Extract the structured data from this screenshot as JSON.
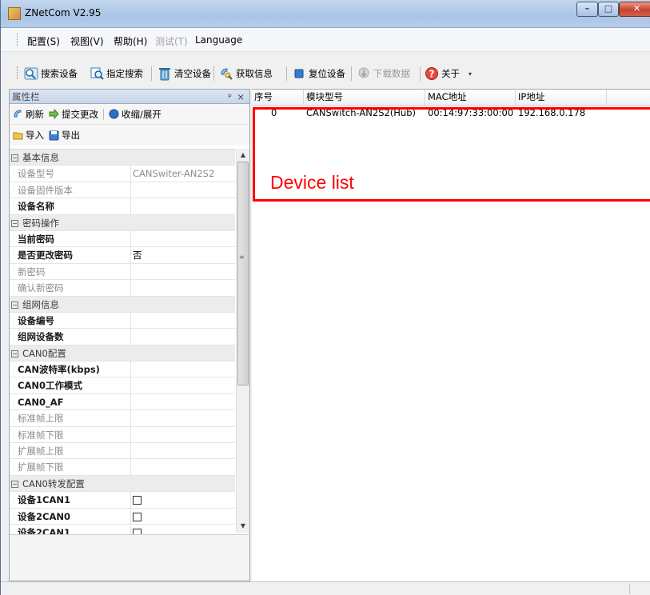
{
  "window": {
    "title": "ZNetCom V2.95"
  },
  "menu": [
    {
      "label": "配置(S)",
      "enabled": true
    },
    {
      "label": "视图(V)",
      "enabled": true
    },
    {
      "label": "帮助(H)",
      "enabled": true
    },
    {
      "label": "测试(T)",
      "enabled": false
    },
    {
      "label": "Language",
      "enabled": true
    }
  ],
  "toolbar": {
    "search_devices": "搜索设备",
    "specified_search": "指定搜索",
    "clear_devices": "清空设备",
    "get_info": "获取信息",
    "reset_device": "复位设备",
    "download_data": "下载数据",
    "about": "关于"
  },
  "property_panel": {
    "title": "属性栏",
    "pin_glyph": "ᵖ",
    "close_glyph": "×",
    "refresh": "刷新",
    "submit_changes": "提交更改",
    "collapse_expand": "收缩/展开",
    "import": "导入",
    "export": "导出",
    "rows": [
      {
        "type": "cat",
        "label": "基本信息"
      },
      {
        "type": "ro",
        "label": "设备型号",
        "value": "CANSwiter-AN2S2"
      },
      {
        "type": "ro",
        "label": "设备固件版本",
        "value": ""
      },
      {
        "type": "bold",
        "label": "设备名称",
        "value": ""
      },
      {
        "type": "cat",
        "label": "密码操作"
      },
      {
        "type": "bold",
        "label": "当前密码",
        "value": ""
      },
      {
        "type": "bold",
        "label": "是否更改密码",
        "value": "否"
      },
      {
        "type": "ro",
        "label": "新密码",
        "value": ""
      },
      {
        "type": "ro",
        "label": "确认新密码",
        "value": ""
      },
      {
        "type": "cat",
        "label": "组网信息"
      },
      {
        "type": "bold",
        "label": "设备编号",
        "value": ""
      },
      {
        "type": "bold",
        "label": "组网设备数",
        "value": ""
      },
      {
        "type": "cat",
        "label": "CAN0配置"
      },
      {
        "type": "bold",
        "label": "CAN波特率(kbps)",
        "value": ""
      },
      {
        "type": "bold",
        "label": "CAN0工作模式",
        "value": ""
      },
      {
        "type": "bold",
        "label": "CAN0_AF",
        "value": ""
      },
      {
        "type": "ro",
        "label": "标准帧上限",
        "value": ""
      },
      {
        "type": "ro",
        "label": "标准帧下限",
        "value": ""
      },
      {
        "type": "ro",
        "label": "扩展帧上限",
        "value": ""
      },
      {
        "type": "ro",
        "label": "扩展帧下限",
        "value": ""
      },
      {
        "type": "cat",
        "label": "CAN0转发配置"
      },
      {
        "type": "bold",
        "label": "设备1CAN1",
        "checkbox": true
      },
      {
        "type": "bold",
        "label": "设备2CAN0",
        "checkbox": true
      },
      {
        "type": "bold",
        "label": "设备2CAN1",
        "checkbox": true
      }
    ]
  },
  "device_list": {
    "columns": [
      "序号",
      "模块型号",
      "MAC地址",
      "IP地址"
    ],
    "rows": [
      [
        "0",
        "CANSwitch-AN2S2(Hub)",
        "00:14:97:33:00:00",
        "192.168.0.178"
      ]
    ]
  },
  "annotation": {
    "text": "Device list",
    "color": "#ff0000"
  }
}
